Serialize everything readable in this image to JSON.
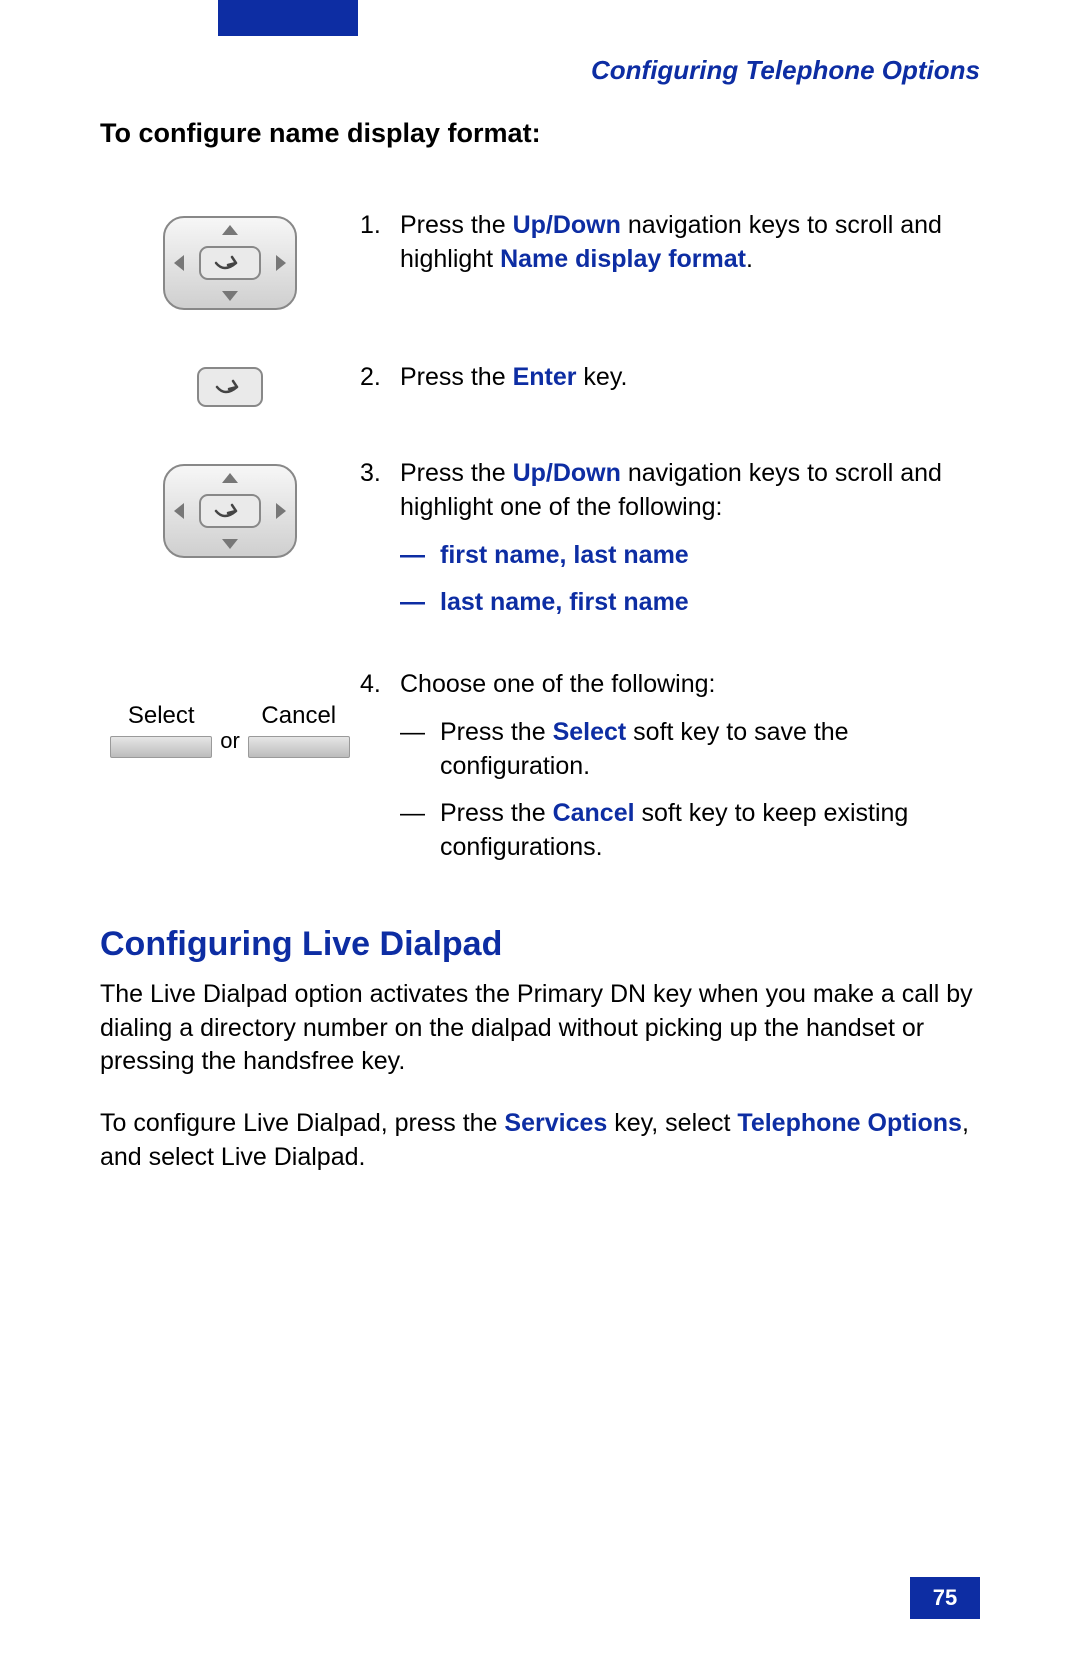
{
  "header": {
    "title": "Configuring Telephone Options"
  },
  "lead": "To configure name display format:",
  "steps": {
    "s1": {
      "num": "1.",
      "text_a": "Press the ",
      "up_down": "Up/Down",
      "text_b": " navigation keys to scroll and highlight ",
      "name_display_format": "Name display format",
      "text_c": "."
    },
    "s2": {
      "num": "2.",
      "text_a": "Press the ",
      "enter": "Enter",
      "text_b": " key."
    },
    "s3": {
      "num": "3.",
      "text_a": "Press the ",
      "up_down": "Up/Down",
      "text_b": " navigation keys to scroll and highlight one of the following:",
      "opt1_dash": "—",
      "opt1": "first name, last name",
      "opt2_dash": "—",
      "opt2": "last name, first name"
    },
    "s4": {
      "num": "4.",
      "text_a": "Choose one of the following:",
      "sub1_dash": "—",
      "sub1_a": "Press the ",
      "sub1_select": "Select",
      "sub1_b": " soft key to save the configuration.",
      "sub2_dash": "—",
      "sub2_a": "Press the ",
      "sub2_cancel": "Cancel",
      "sub2_b": " soft key to keep existing configurations."
    }
  },
  "softkeys": {
    "select": "Select",
    "or": "or",
    "cancel": "Cancel"
  },
  "section2": {
    "heading": "Configuring Live Dialpad",
    "p1": "The Live Dialpad option activates the Primary DN key when you make a call by dialing a directory number on the dialpad without picking up the handset or pressing the handsfree key.",
    "p2_a": "To configure Live Dialpad, press the ",
    "p2_services": "Services",
    "p2_b": " key, select ",
    "p2_tel": "Telephone Options",
    "p2_c": ", and select Live Dialpad."
  },
  "page_number": "75"
}
